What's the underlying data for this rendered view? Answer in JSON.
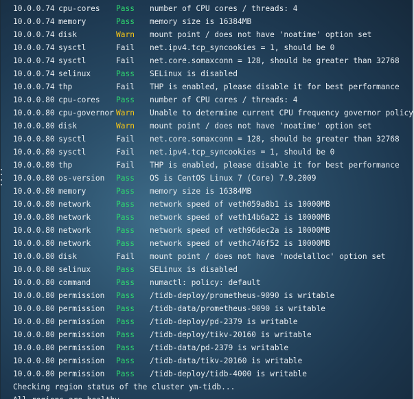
{
  "colors": {
    "pass": "#2ed86f",
    "warn": "#f5c518",
    "fail": "#e8edf1",
    "text": "#e8edf1"
  },
  "terminal": {
    "rows": [
      {
        "host": "10.0.0.74",
        "check": "cpu-cores",
        "result": "Pass",
        "message": "number of CPU cores / threads: 4"
      },
      {
        "host": "10.0.0.74",
        "check": "memory",
        "result": "Pass",
        "message": "memory size is 16384MB"
      },
      {
        "host": "10.0.0.74",
        "check": "disk",
        "result": "Warn",
        "message": "mount point / does not have 'noatime' option set"
      },
      {
        "host": "10.0.0.74",
        "check": "sysctl",
        "result": "Fail",
        "message": "net.ipv4.tcp_syncookies = 1, should be 0"
      },
      {
        "host": "10.0.0.74",
        "check": "sysctl",
        "result": "Fail",
        "message": "net.core.somaxconn = 128, should be greater than 32768"
      },
      {
        "host": "10.0.0.74",
        "check": "selinux",
        "result": "Pass",
        "message": "SELinux is disabled"
      },
      {
        "host": "10.0.0.74",
        "check": "thp",
        "result": "Fail",
        "message": "THP is enabled, please disable it for best performance"
      },
      {
        "host": "10.0.0.80",
        "check": "cpu-cores",
        "result": "Pass",
        "message": "number of CPU cores / threads: 4"
      },
      {
        "host": "10.0.0.80",
        "check": "cpu-governor",
        "result": "Warn",
        "message": "Unable to determine current CPU frequency governor policy"
      },
      {
        "host": "10.0.0.80",
        "check": "disk",
        "result": "Warn",
        "message": "mount point / does not have 'noatime' option set"
      },
      {
        "host": "10.0.0.80",
        "check": "sysctl",
        "result": "Fail",
        "message": "net.core.somaxconn = 128, should be greater than 32768"
      },
      {
        "host": "10.0.0.80",
        "check": "sysctl",
        "result": "Fail",
        "message": "net.ipv4.tcp_syncookies = 1, should be 0"
      },
      {
        "host": "10.0.0.80",
        "check": "thp",
        "result": "Fail",
        "message": "THP is enabled, please disable it for best performance"
      },
      {
        "host": "10.0.0.80",
        "check": "os-version",
        "result": "Pass",
        "message": "OS is CentOS Linux 7 (Core) 7.9.2009"
      },
      {
        "host": "10.0.0.80",
        "check": "memory",
        "result": "Pass",
        "message": "memory size is 16384MB"
      },
      {
        "host": "10.0.0.80",
        "check": "network",
        "result": "Pass",
        "message": "network speed of veth059a8b1 is 10000MB"
      },
      {
        "host": "10.0.0.80",
        "check": "network",
        "result": "Pass",
        "message": "network speed of veth14b6a22 is 10000MB"
      },
      {
        "host": "10.0.0.80",
        "check": "network",
        "result": "Pass",
        "message": "network speed of veth96dec2a is 10000MB"
      },
      {
        "host": "10.0.0.80",
        "check": "network",
        "result": "Pass",
        "message": "network speed of vethc746f52 is 10000MB"
      },
      {
        "host": "10.0.0.80",
        "check": "disk",
        "result": "Fail",
        "message": "mount point / does not have 'nodelalloc' option set"
      },
      {
        "host": "10.0.0.80",
        "check": "selinux",
        "result": "Pass",
        "message": "SELinux is disabled"
      },
      {
        "host": "10.0.0.80",
        "check": "command",
        "result": "Pass",
        "message": "numactl: policy: default"
      },
      {
        "host": "10.0.0.80",
        "check": "permission",
        "result": "Pass",
        "message": "/tidb-deploy/prometheus-9090 is writable"
      },
      {
        "host": "10.0.0.80",
        "check": "permission",
        "result": "Pass",
        "message": "/tidb-data/prometheus-9090 is writable"
      },
      {
        "host": "10.0.0.80",
        "check": "permission",
        "result": "Pass",
        "message": "/tidb-deploy/pd-2379 is writable"
      },
      {
        "host": "10.0.0.80",
        "check": "permission",
        "result": "Pass",
        "message": "/tidb-deploy/tikv-20160 is writable"
      },
      {
        "host": "10.0.0.80",
        "check": "permission",
        "result": "Pass",
        "message": "/tidb-data/pd-2379 is writable"
      },
      {
        "host": "10.0.0.80",
        "check": "permission",
        "result": "Pass",
        "message": "/tidb-data/tikv-20160 is writable"
      },
      {
        "host": "10.0.0.80",
        "check": "permission",
        "result": "Pass",
        "message": "/tidb-deploy/tidb-4000 is writable"
      }
    ],
    "footer": [
      "Checking region status of the cluster ym-tidb...",
      "All regions are healthy."
    ]
  }
}
